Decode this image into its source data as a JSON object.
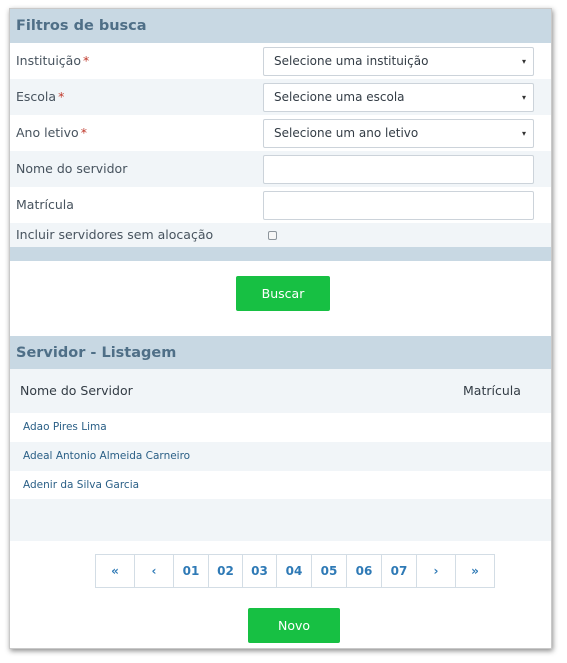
{
  "filters": {
    "title": "Filtros de busca",
    "fields": [
      {
        "label": "Instituição",
        "required_mark": "*",
        "value": "Selecione uma instituição"
      },
      {
        "label": "Escola",
        "required_mark": "*",
        "value": "Selecione uma escola"
      },
      {
        "label": "Ano letivo",
        "required_mark": "*",
        "value": "Selecione um ano letivo"
      },
      {
        "label": "Nome do servidor",
        "value": ""
      },
      {
        "label": "Matrícula",
        "value": ""
      },
      {
        "label": "Incluir servidores sem alocação",
        "checked": false
      }
    ],
    "caret_icon": "▾",
    "search_button": "Buscar"
  },
  "listing": {
    "title": "Servidor - Listagem",
    "columns": [
      "Nome do Servidor",
      "Matrícula"
    ],
    "rows": [
      {
        "name": "Adao Pires Lima",
        "matricula": ""
      },
      {
        "name": "Adeal Antonio Almeida Carneiro",
        "matricula": ""
      },
      {
        "name": "Adenir da Silva Garcia",
        "matricula": ""
      }
    ]
  },
  "pagination": {
    "first": "«",
    "prev": "‹",
    "pages": [
      "01",
      "02",
      "03",
      "04",
      "05",
      "06",
      "07"
    ],
    "next": "›",
    "last": "»"
  },
  "new_button": "Novo",
  "colors": {
    "header_bg": "#c8d8e3",
    "header_text": "#4f6f87",
    "button_green": "#17c043",
    "link_blue": "#2f7ab6",
    "required_red": "#c0392b"
  }
}
